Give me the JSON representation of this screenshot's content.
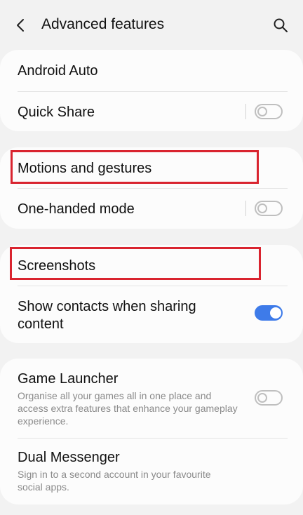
{
  "header": {
    "title": "Advanced features",
    "back_icon": "chevron-left-icon",
    "search_icon": "search-icon"
  },
  "cards": [
    {
      "items": [
        {
          "label": "Android Auto"
        },
        {
          "label": "Quick Share",
          "toggle": false
        }
      ]
    },
    {
      "items": [
        {
          "label": "Motions and gestures"
        },
        {
          "label": "One-handed mode",
          "toggle": false
        }
      ]
    },
    {
      "items": [
        {
          "label": "Screenshots"
        },
        {
          "label": "Show contacts when sharing content",
          "toggle": true
        }
      ]
    },
    {
      "items": [
        {
          "label": "Game Launcher",
          "sub": "Organise all your games all in one place and access extra features that enhance your gameplay experience.",
          "toggle": false
        },
        {
          "label": "Dual Messenger",
          "sub": "Sign in to a second account in your favourite social apps."
        }
      ]
    }
  ],
  "colors": {
    "background": "#f2f2f2",
    "card": "#fcfcfc",
    "accent": "#3e7be9",
    "highlight_box": "#d9242f",
    "secondary_text": "#8a8a8a"
  }
}
